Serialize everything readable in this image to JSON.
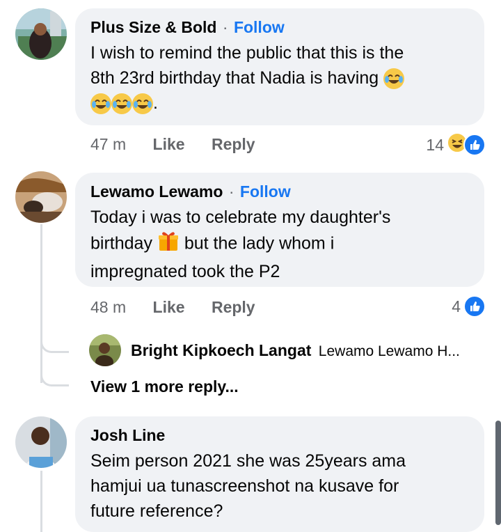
{
  "comments": [
    {
      "author": "Plus Size & Bold",
      "follow": "Follow",
      "text_line1": "I wish to remind the public that this is the",
      "text_line2": "8th 23rd birthday that Nadia is having",
      "text_line3_end": ".",
      "time": "47 m",
      "like": "Like",
      "reply": "Reply",
      "reaction_count": "14",
      "icons": [
        "laughing-tears-emoji",
        "haha-react",
        "like-react"
      ]
    },
    {
      "author": "Lewamo Lewamo",
      "follow": "Follow",
      "text_line1": "Today i was to celebrate my daughter's",
      "text_line2_a": "birthday",
      "text_line2_b": "but the lady whom i",
      "text_line3": "impregnated took the P2",
      "time": "48 m",
      "like": "Like",
      "reply": "Reply",
      "reaction_count": "4",
      "icons": [
        "gift-emoji",
        "like-react"
      ]
    },
    {
      "author": "Josh Line",
      "text_line1": "Seim person 2021 she was 25years ama",
      "text_line2": "hamjui ua tunascreenshot na kusave for",
      "text_line3": "future reference?"
    }
  ],
  "nested_reply": {
    "author": "Bright Kipkoech Langat",
    "preview": "Lewamo Lewamo H..."
  },
  "view_more": "View 1 more reply...",
  "colors": {
    "link": "#1877f2",
    "bubble": "#f0f2f5",
    "meta": "#65676b"
  }
}
